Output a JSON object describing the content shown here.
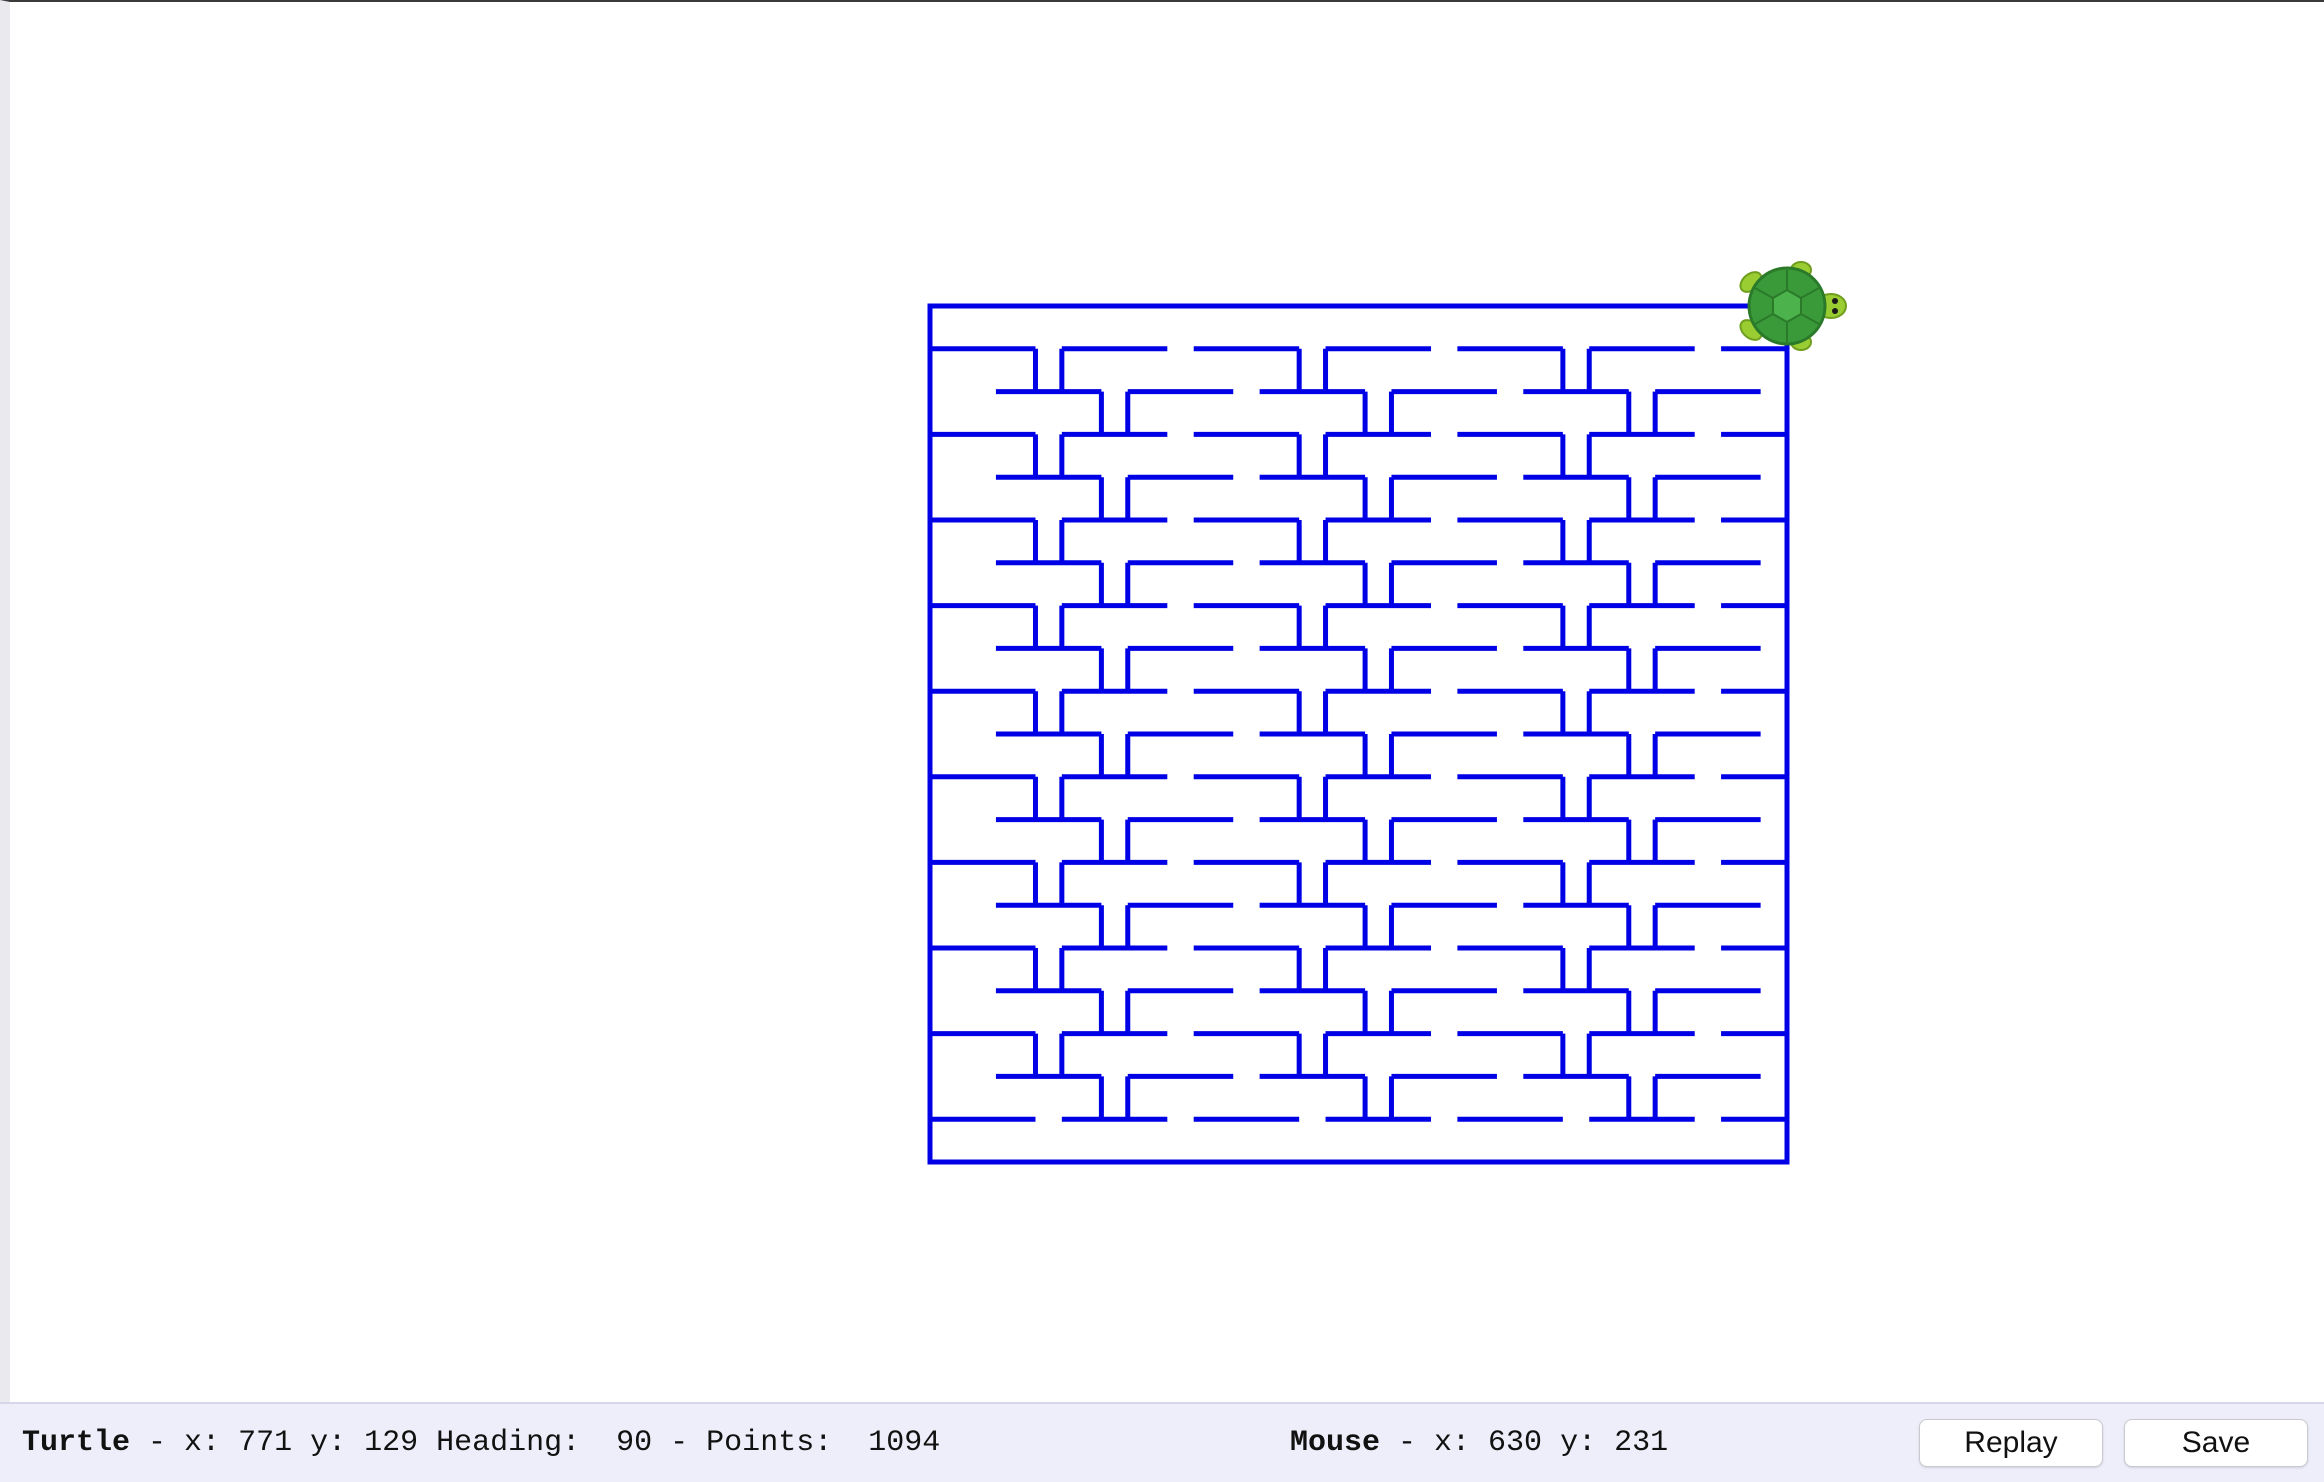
{
  "status": {
    "turtle_label": "Turtle",
    "turtle_x_label": " - x: ",
    "turtle_x": "771",
    "turtle_y_label": " y: ",
    "turtle_y": "129",
    "heading_label": " Heading:  ",
    "heading": "90",
    "points_label": " - Points:  ",
    "points": "1094",
    "mouse_label": "Mouse",
    "mouse_x_label": " - x: ",
    "mouse_x": "630",
    "mouse_y_label": " y: ",
    "mouse_y": "231"
  },
  "buttons": {
    "replay_label": "Replay",
    "save_label": "Save"
  },
  "drawing": {
    "stroke_color": "#0000e6",
    "turtle_icon": "turtle-icon",
    "pattern_rows": [
      "3",
      "1",
      "3",
      "1",
      "3",
      "1",
      "3",
      "1",
      "3",
      "1",
      "3",
      "1",
      "3",
      "1",
      "3",
      "1",
      "3",
      "1",
      "3"
    ]
  },
  "colors": {
    "background": "#ffffff",
    "status_bar": "#eeeefa",
    "turtle_shell": "#3a9a3a",
    "turtle_skin": "#9acd32"
  }
}
